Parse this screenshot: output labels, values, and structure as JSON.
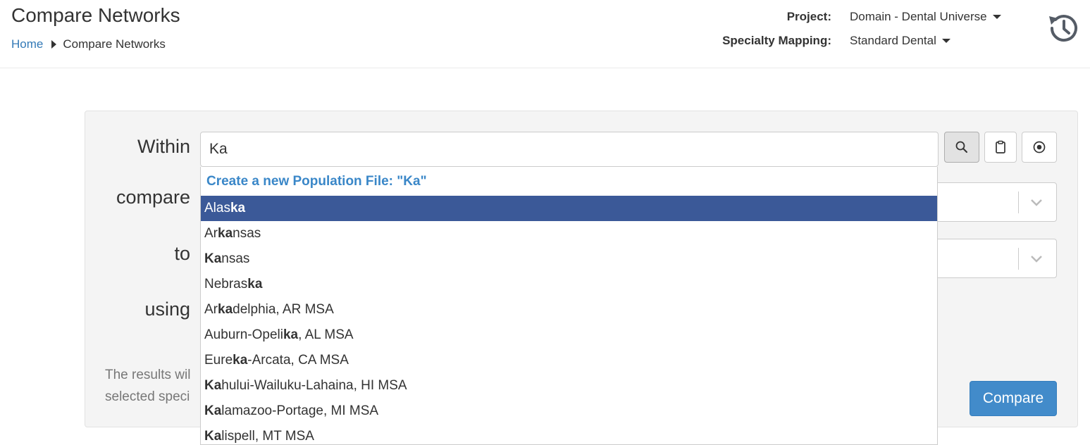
{
  "header": {
    "title": "Compare Networks",
    "breadcrumb": {
      "home": "Home",
      "current": "Compare Networks"
    },
    "project_label": "Project:",
    "project_value": "Domain - Dental Universe",
    "specialty_label": "Specialty Mapping:",
    "specialty_value": "Standard Dental",
    "history_icon": "history-icon"
  },
  "form": {
    "within_label": "Within",
    "within_value": "Ka",
    "compare_label": "compare",
    "to_label": "to",
    "using_label": "using",
    "buttons": [
      "search-icon",
      "clipboard-icon",
      "target-icon"
    ],
    "info_line1": "The results wil",
    "info_line2": "selected speci",
    "compare_button": "Compare"
  },
  "dropdown": {
    "create_label": "Create a new Population File: \"Ka\"",
    "items": [
      {
        "pre": "Alas",
        "match": "ka",
        "post": "",
        "active": true
      },
      {
        "pre": "Ar",
        "match": "ka",
        "post": "nsas"
      },
      {
        "pre": "",
        "match": "Ka",
        "post": "nsas"
      },
      {
        "pre": "Nebras",
        "match": "ka",
        "post": ""
      },
      {
        "pre": "Ar",
        "match": "ka",
        "post": "delphia, AR MSA"
      },
      {
        "pre": "Auburn-Opeli",
        "match": "ka",
        "post": ", AL MSA"
      },
      {
        "pre": "Eure",
        "match": "ka",
        "post": "-Arcata, CA MSA"
      },
      {
        "pre": "",
        "match": "Ka",
        "post": "hului-Wailuku-Lahaina, HI MSA"
      },
      {
        "pre": "",
        "match": "Ka",
        "post": "lamazoo-Portage, MI MSA"
      },
      {
        "pre": "",
        "match": "Ka",
        "post": "lispell, MT MSA"
      }
    ]
  },
  "colors": {
    "accent": "#428bca",
    "highlight": "#3b5998",
    "link": "#337ab7"
  }
}
